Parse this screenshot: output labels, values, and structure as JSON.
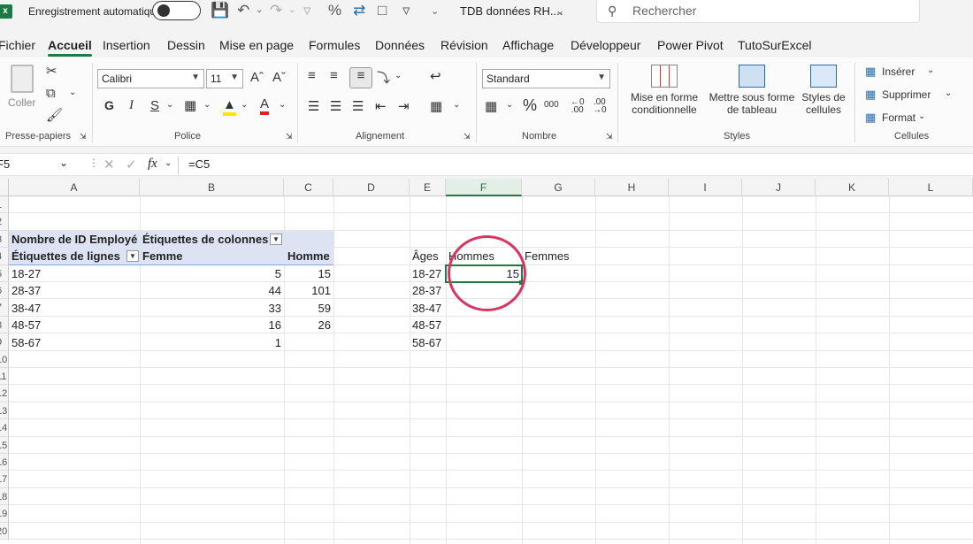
{
  "titlebar": {
    "autosave_label": "Enregistrement automatique",
    "file_name": "TDB données RH....",
    "search_placeholder": "Rechercher"
  },
  "menu": [
    "Fichier",
    "Accueil",
    "Insertion",
    "Dessin",
    "Mise en page",
    "Formules",
    "Données",
    "Révision",
    "Affichage",
    "Développeur",
    "Power Pivot",
    "TutoSurExcel"
  ],
  "ribbon": {
    "clipboard": {
      "paste_label": "Coller",
      "group": "Presse-papiers"
    },
    "font": {
      "name": "Calibri",
      "size": "11",
      "bold": "G",
      "italic": "I",
      "underline": "S",
      "group": "Police"
    },
    "alignment": {
      "group": "Alignement"
    },
    "number": {
      "format": "Standard",
      "group": "Nombre"
    },
    "styles": {
      "cond1": "Mise en forme",
      "cond2": "conditionnelle",
      "table1": "Mettre sous forme",
      "table2": "de tableau",
      "cell1": "Styles de",
      "cell2": "cellules",
      "group": "Styles"
    },
    "cells": {
      "insert": "Insérer",
      "delete": "Supprimer",
      "format": "Format",
      "group": "Cellules"
    }
  },
  "formulabar": {
    "name_box": "F5",
    "fx": "fx",
    "formula": "=C5"
  },
  "grid": {
    "columns": [
      "A",
      "B",
      "C",
      "D",
      "E",
      "F",
      "G",
      "H",
      "I",
      "J",
      "K",
      "L"
    ],
    "row_numbers": [
      "1",
      "2",
      "3",
      "4",
      "5",
      "6",
      "7",
      "8",
      "9",
      "10",
      "11",
      "12",
      "13",
      "14",
      "15",
      "16",
      "17",
      "18",
      "19",
      "20"
    ]
  },
  "pivot": {
    "title": "Nombre de ID Employé",
    "col_labels": "Étiquettes de colonnes",
    "row_labels": "Étiquettes de lignes",
    "col_femme": "Femme",
    "col_homme": "Homme",
    "rows": [
      {
        "label": "18-27",
        "femme": "5",
        "homme": "15"
      },
      {
        "label": "28-37",
        "femme": "44",
        "homme": "101"
      },
      {
        "label": "38-47",
        "femme": "33",
        "homme": "59"
      },
      {
        "label": "48-57",
        "femme": "16",
        "homme": "26"
      },
      {
        "label": "58-67",
        "femme": "1",
        "homme": ""
      }
    ]
  },
  "table": {
    "h_ages": "Âges",
    "h_hommes": "Hommes",
    "h_femmes": "Femmes",
    "ages": [
      "18-27",
      "28-37",
      "38-47",
      "48-57",
      "58-67"
    ],
    "f5": "15"
  }
}
